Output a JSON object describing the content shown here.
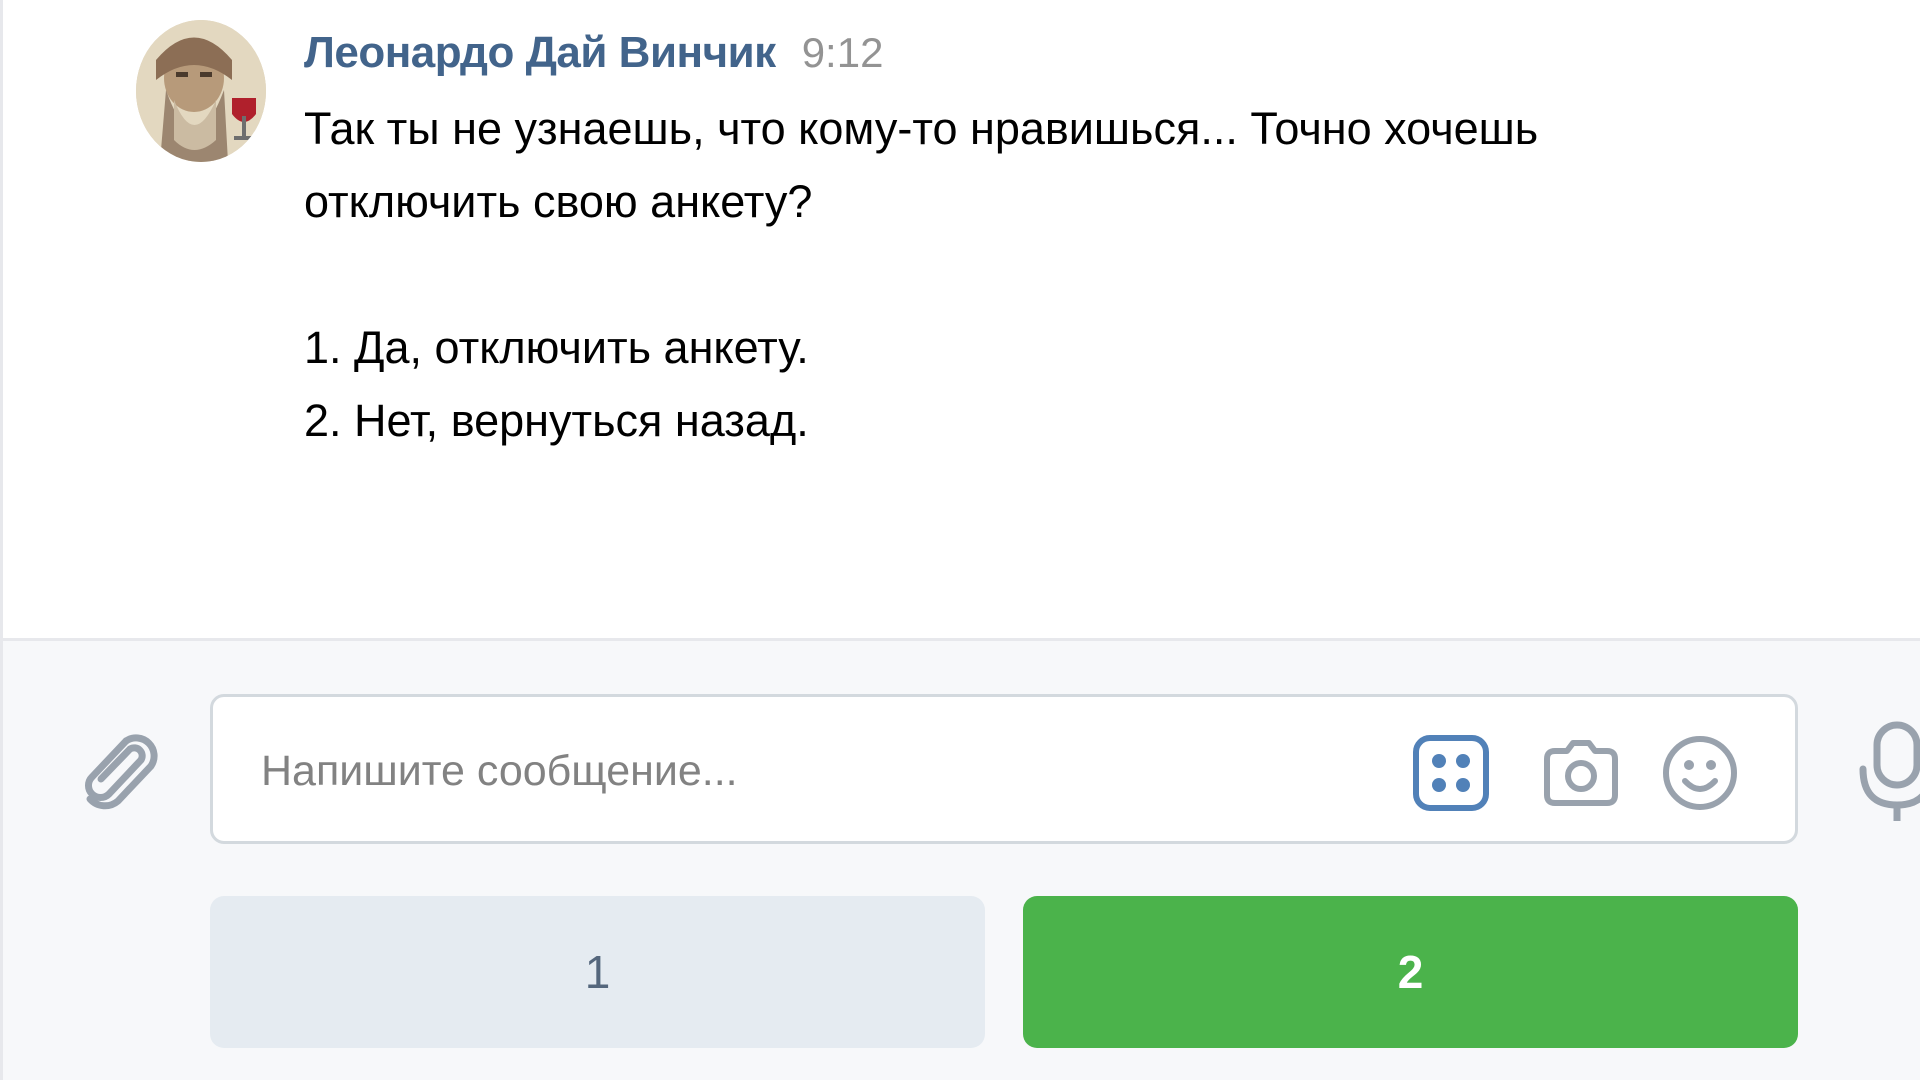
{
  "message": {
    "author": "Леонардо Дай Винчик",
    "time": "9:12",
    "lines": [
      "Так ты не узнаешь, что кому-то нравишься... Точно хочешь",
      "отключить свою анкету?",
      "",
      "1. Да, отключить анкету.",
      "2. Нет, вернуться назад."
    ]
  },
  "composer": {
    "placeholder": "Напишите сообщение...",
    "attach_icon": "paperclip-icon",
    "keyboard_icon": "bot-keyboard-icon",
    "camera_icon": "camera-icon",
    "emoji_icon": "smile-icon",
    "mic_icon": "microphone-icon"
  },
  "keyboard": {
    "buttons": [
      {
        "label": "1",
        "color": "#e5ebf1",
        "text_color": "#55677d"
      },
      {
        "label": "2",
        "color": "#4bb34b",
        "text_color": "#ffffff"
      }
    ]
  },
  "colors": {
    "author": "#42648b",
    "time": "#939393",
    "icon": "#99a2ad",
    "accent": "#5181b8"
  }
}
